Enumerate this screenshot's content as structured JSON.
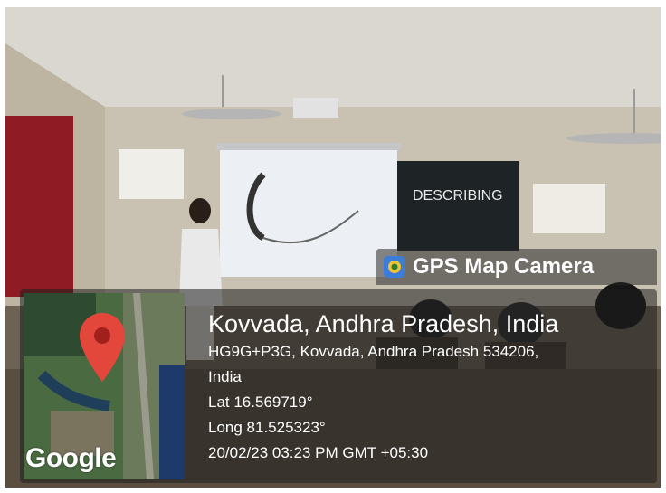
{
  "badge": {
    "label": "GPS Map Camera"
  },
  "location": {
    "title": "Kovvada, Andhra Pradesh, India",
    "address_line1": "HG9G+P3G, Kovvada, Andhra Pradesh 534206,",
    "address_line2": "India",
    "lat": "Lat 16.569719°",
    "long": "Long 81.525323°",
    "datetime": "20/02/23 03:23 PM GMT +05:30"
  },
  "map": {
    "brand": "Google",
    "pin_icon": "map-pin-icon",
    "pin_color": "#e3473c"
  },
  "screen": {
    "board_text": "DESCRIBING"
  }
}
